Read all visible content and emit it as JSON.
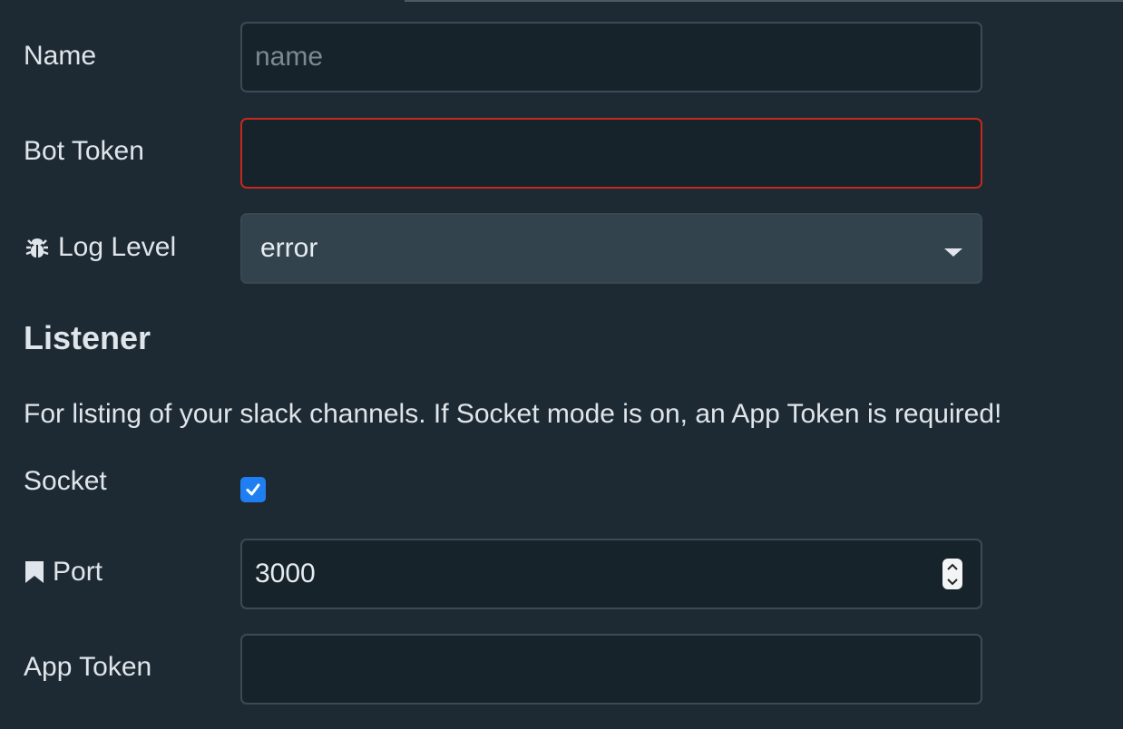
{
  "fields": {
    "name": {
      "label": "Name",
      "placeholder": "name",
      "value": ""
    },
    "bot_token": {
      "label": "Bot Token",
      "value": ""
    },
    "log_level": {
      "label": "Log Level",
      "value": "error",
      "icon": "bug-icon"
    },
    "socket": {
      "label": "Socket",
      "checked": true
    },
    "port": {
      "label": "Port",
      "value": "3000",
      "icon": "bookmark-icon"
    },
    "app_token": {
      "label": "App Token",
      "value": ""
    }
  },
  "listener": {
    "title": "Listener",
    "description": "For listing of your slack channels. If Socket mode is on, an App Token is required!"
  },
  "colors": {
    "background": "#1e2a33",
    "input_bg": "#17232b",
    "select_bg": "#33434d",
    "error_border": "#c4291d",
    "checkbox": "#1f7ff2"
  }
}
